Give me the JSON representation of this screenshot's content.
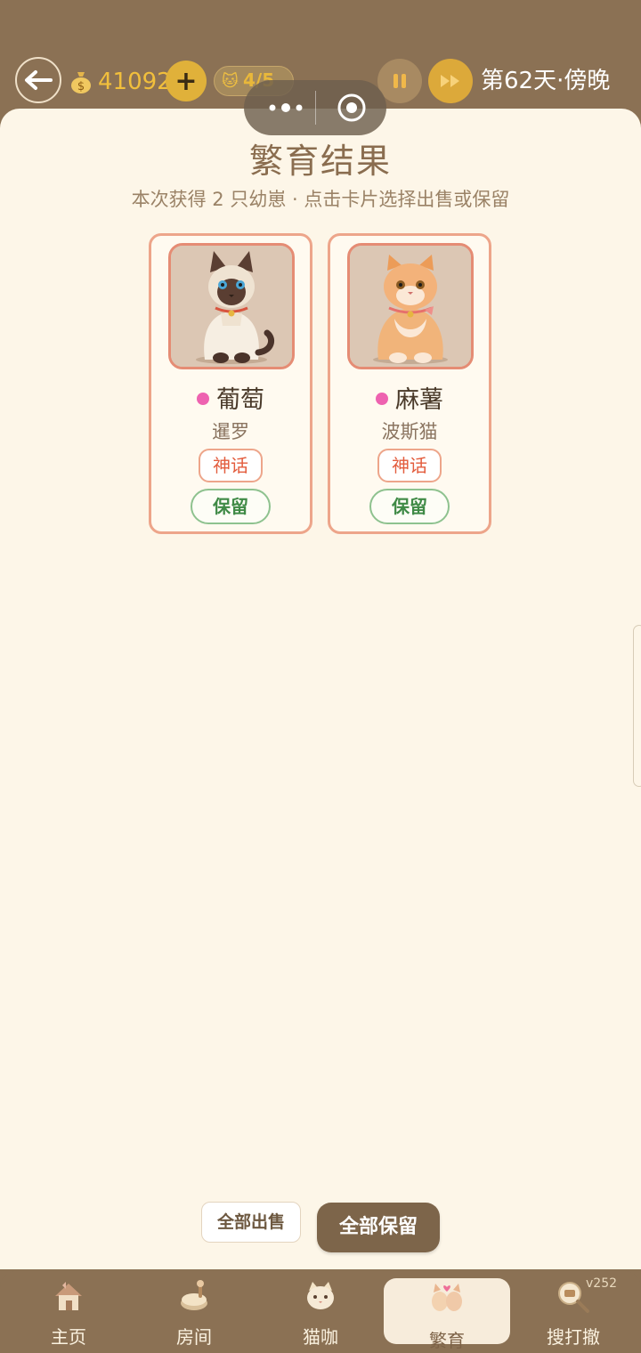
{
  "header": {
    "coins": "41092",
    "add_symbol": "+",
    "cat_count": "4/5",
    "day_label": "第62天·傍晚"
  },
  "breeding": {
    "title": "繁育结果",
    "subtitle": "本次获得 2 只幼崽 · 点击卡片选择出售或保留",
    "kittens": [
      {
        "name": "葡萄",
        "breed": "暹罗",
        "rarity": "神话",
        "action": "保留",
        "dot_color": "#ee62b0"
      },
      {
        "name": "麻薯",
        "breed": "波斯猫",
        "rarity": "神话",
        "action": "保留",
        "dot_color": "#ee62b0"
      }
    ],
    "sell_all": "全部出售",
    "keep_all": "全部保留"
  },
  "nav": {
    "items": [
      {
        "label": "主页",
        "icon": "house-icon"
      },
      {
        "label": "房间",
        "icon": "room-icon"
      },
      {
        "label": "猫咖",
        "icon": "cat-cafe-icon"
      },
      {
        "label": "繁育",
        "icon": "breeding-icon",
        "active": true
      },
      {
        "label": "搜打撤",
        "icon": "search-raid-icon"
      }
    ],
    "version": "v252"
  },
  "colors": {
    "brown": "#8b7154",
    "panel": "#fdf6e8",
    "gold": "#e0b13a",
    "rarity_red": "#e35d3e",
    "keep_green": "#3f8a46"
  }
}
